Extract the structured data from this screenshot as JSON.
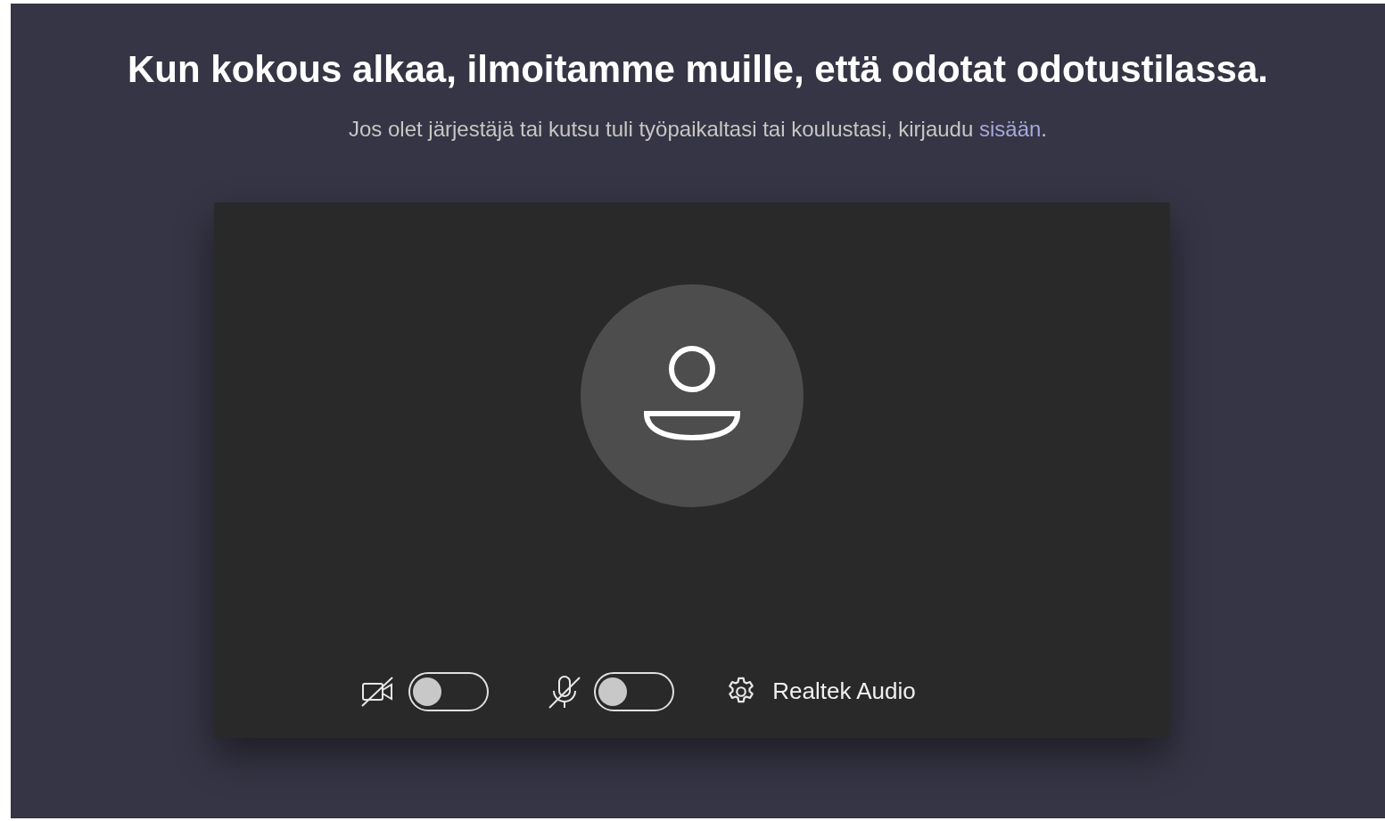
{
  "heading": "Kun kokous alkaa, ilmoitamme muille, että odotat odotustilassa.",
  "subtitle": {
    "text": "Jos olet järjestäjä tai kutsu tuli työpaikaltasi tai koulustasi, kirjaudu",
    "link": "sisään",
    "after": "."
  },
  "preview": {
    "controls": [
      {
        "kind": "camera",
        "on": false
      },
      {
        "kind": "microphone",
        "on": false
      }
    ],
    "device": "Realtek Audio"
  }
}
